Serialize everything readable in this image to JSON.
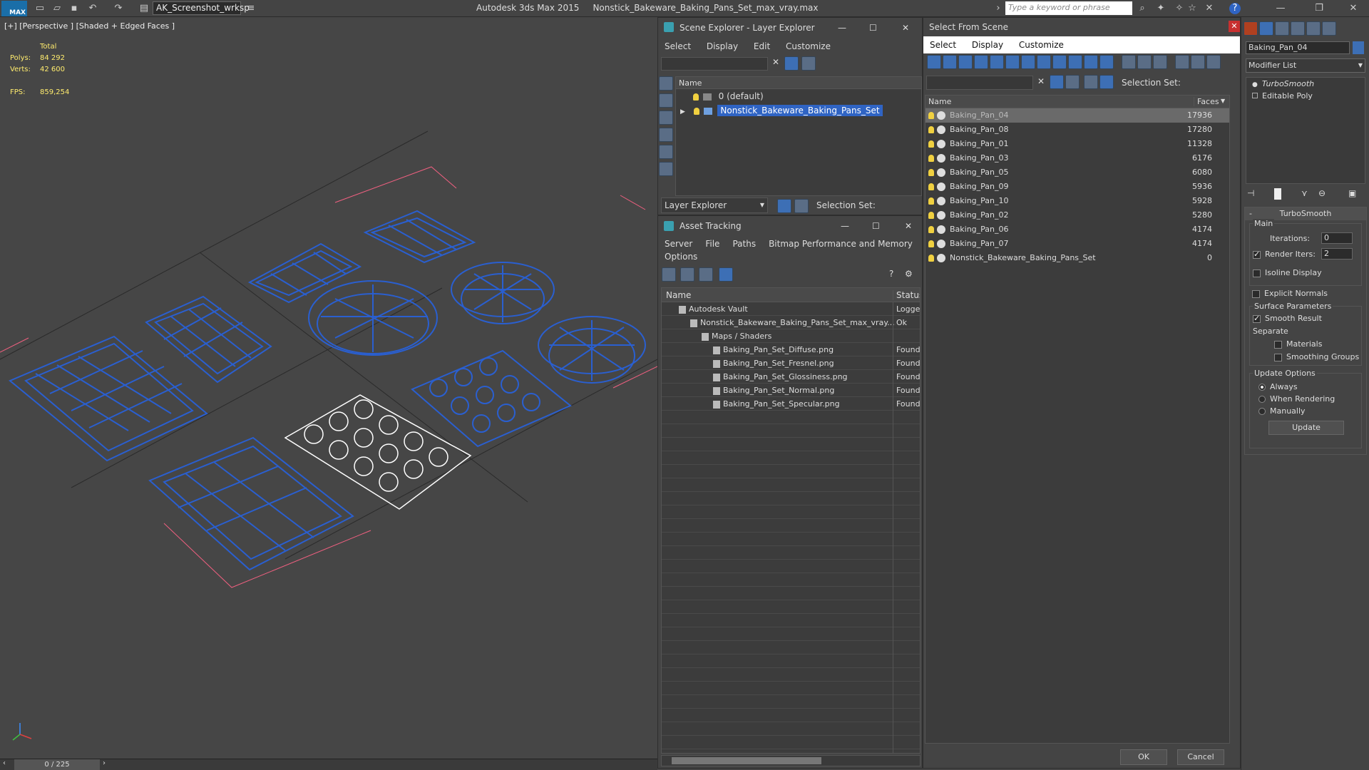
{
  "titlebar": {
    "workspace": "AK_Screenshot_wrksp",
    "app_name": "Autodesk 3ds Max 2015",
    "file_name": "Nonstick_Bakeware_Baking_Pans_Set_max_vray.max",
    "search_placeholder": "Type a keyword or phrase",
    "logo_text": "MAX"
  },
  "viewport": {
    "label": "[+] [Perspective ] [Shaded + Edged Faces ]",
    "stats": {
      "total_label": "Total",
      "polys_label": "Polys:",
      "polys_value": "84 292",
      "verts_label": "Verts:",
      "verts_value": "42 600",
      "fps_label": "FPS:",
      "fps_value": "859,254"
    }
  },
  "timeline": {
    "frame": "0 / 225"
  },
  "scene_explorer": {
    "title": "Scene Explorer - Layer Explorer",
    "menu": [
      "Select",
      "Display",
      "Edit",
      "Customize"
    ],
    "column_name": "Name",
    "layers": [
      {
        "name": "0 (default)"
      },
      {
        "name": "Nonstick_Bakeware_Baking_Pans_Set"
      }
    ],
    "footer_dropdown": "Layer Explorer",
    "selection_set_label": "Selection Set:"
  },
  "asset_tracking": {
    "title": "Asset Tracking",
    "menu": [
      "Server",
      "File",
      "Paths",
      "Bitmap Performance and Memory",
      "Options"
    ],
    "col_name": "Name",
    "col_status": "Status",
    "rows": [
      {
        "name": "Autodesk Vault",
        "status": "Logge",
        "indent": 0
      },
      {
        "name": "Nonstick_Bakeware_Baking_Pans_Set_max_vray....",
        "status": "Ok",
        "indent": 1
      },
      {
        "name": "Maps / Shaders",
        "status": "",
        "indent": 2
      },
      {
        "name": "Baking_Pan_Set_Diffuse.png",
        "status": "Found",
        "indent": 3
      },
      {
        "name": "Baking_Pan_Set_Fresnel.png",
        "status": "Found",
        "indent": 3
      },
      {
        "name": "Baking_Pan_Set_Glossiness.png",
        "status": "Found",
        "indent": 3
      },
      {
        "name": "Baking_Pan_Set_Normal.png",
        "status": "Found",
        "indent": 3
      },
      {
        "name": "Baking_Pan_Set_Specular.png",
        "status": "Found",
        "indent": 3
      }
    ]
  },
  "select_from_scene": {
    "title": "Select From Scene",
    "menu": [
      "Select",
      "Display",
      "Customize"
    ],
    "selection_set_label": "Selection Set:",
    "col_name": "Name",
    "col_faces": "Faces",
    "rows": [
      {
        "name": "Baking_Pan_04",
        "faces": "17936"
      },
      {
        "name": "Baking_Pan_08",
        "faces": "17280"
      },
      {
        "name": "Baking_Pan_01",
        "faces": "11328"
      },
      {
        "name": "Baking_Pan_03",
        "faces": "6176"
      },
      {
        "name": "Baking_Pan_05",
        "faces": "6080"
      },
      {
        "name": "Baking_Pan_09",
        "faces": "5936"
      },
      {
        "name": "Baking_Pan_10",
        "faces": "5928"
      },
      {
        "name": "Baking_Pan_02",
        "faces": "5280"
      },
      {
        "name": "Baking_Pan_06",
        "faces": "4174"
      },
      {
        "name": "Baking_Pan_07",
        "faces": "4174"
      },
      {
        "name": "Nonstick_Bakeware_Baking_Pans_Set",
        "faces": "0"
      }
    ],
    "ok": "OK",
    "cancel": "Cancel"
  },
  "command_panel": {
    "object_name": "Baking_Pan_04",
    "modifier_list": "Modifier List",
    "stack": [
      "TurboSmooth",
      "Editable Poly"
    ],
    "rollout_title": "TurboSmooth",
    "main_label": "Main",
    "iterations_label": "Iterations:",
    "iterations_value": "0",
    "render_iters_label": "Render Iters:",
    "render_iters_value": "2",
    "isoline": "Isoline Display",
    "explicit_normals": "Explicit Normals",
    "surface_params": "Surface Parameters",
    "smooth_result": "Smooth Result",
    "separate": "Separate",
    "materials": "Materials",
    "smoothing_groups": "Smoothing Groups",
    "update_options": "Update Options",
    "always": "Always",
    "when_rendering": "When Rendering",
    "manually": "Manually",
    "update_button": "Update"
  },
  "colors": {
    "wire_blue": "#2a5fd0",
    "wire_white": "#ffffff",
    "selection_blue": "#2f64c4",
    "viewport_bg": "#464646",
    "stats_yellow": "#ffec6e"
  }
}
